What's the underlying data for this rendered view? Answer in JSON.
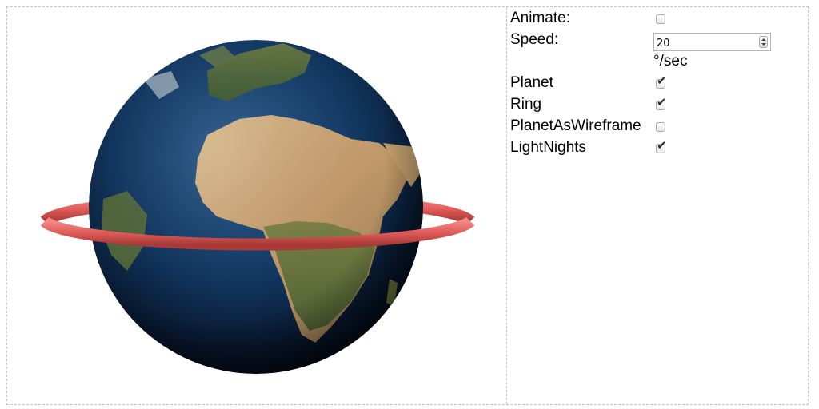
{
  "controls": {
    "animate": {
      "label": "Animate:",
      "checked": false
    },
    "speed": {
      "label": "Speed:",
      "value": "20",
      "unit": "°/sec"
    },
    "planet": {
      "label": "Planet",
      "checked": true
    },
    "ring": {
      "label": "Ring",
      "checked": true
    },
    "planet_as_wireframe": {
      "label": "PlanetAsWireframe",
      "checked": false
    },
    "light_nights": {
      "label": "LightNights",
      "checked": true
    }
  },
  "scene": {
    "ring_color": "#e05a58",
    "ocean_color": "#0f2a52",
    "land_color": "#c7a57a"
  },
  "icons": {
    "check": "✔"
  }
}
